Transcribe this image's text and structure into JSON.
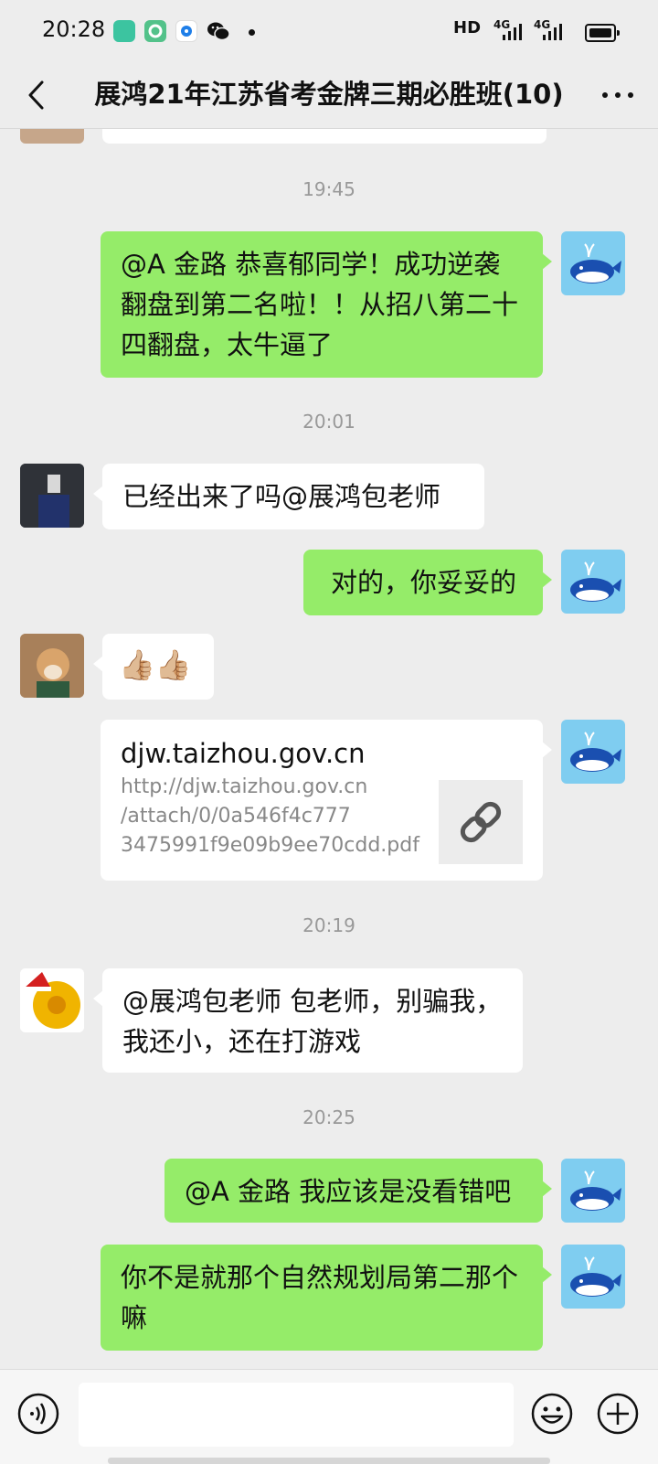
{
  "status_bar": {
    "time": "20:28",
    "network": "HD",
    "signal_1": "4G",
    "signal_2": "4G"
  },
  "header": {
    "title": "展鸿21年江苏省考金牌三期必胜班(10)"
  },
  "messages": {
    "ts1": "19:45",
    "m1": [
      "@A 金路  恭喜郁同学！成功逆袭",
      "翻盘到第二名啦！！从招八第二十",
      "四翻盘，太牛逼了"
    ],
    "ts2": "20:01",
    "m2": "已经出来了吗@展鸿包老师",
    "m3": "对的，你妥妥的",
    "m4": "👍🏼👍🏼",
    "link": {
      "title": "djw.taizhou.gov.cn",
      "url_lines": [
        "http://djw.taizhou.gov.cn",
        "/attach/0/0a546f4c777",
        "3475991f9e09b9ee70cdd.pdf"
      ]
    },
    "ts3": "20:19",
    "m5": [
      "@展鸿包老师  包老师，别骗我，",
      "我还小，还在打游戏"
    ],
    "ts4": "20:25",
    "m6": "@A 金路  我应该是没看错吧",
    "m7": [
      "你不是就那个自然规划局第二那个",
      "嘛"
    ]
  },
  "colors": {
    "my_bubble": "#95ec69",
    "other_bubble": "#ffffff",
    "background": "#ededed"
  }
}
